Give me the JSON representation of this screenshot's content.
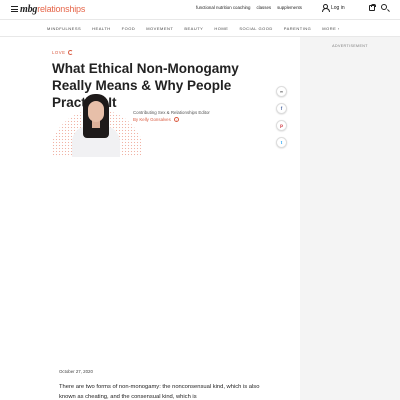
{
  "header": {
    "logo_mbg": "mbg",
    "logo_suffix": "relationships",
    "links": [
      "functional nutrition coaching",
      "classes",
      "supplements"
    ],
    "login_label": "Log in"
  },
  "nav": {
    "items": [
      "MINDFULNESS",
      "HEALTH",
      "FOOD",
      "MOVEMENT",
      "BEAUTY",
      "HOME",
      "SOCIAL GOOD",
      "PARENTING",
      "MORE"
    ]
  },
  "rail": {
    "ad_label": "ADVERTISEMENT"
  },
  "article": {
    "category": "LOVE",
    "title": "What Ethical Non-Monogamy Really Means & Why People Practice It",
    "author_role": "Contributing Sex & Relationships Editor",
    "author_name": "By Kelly Gonsalves",
    "date": "October 27, 2020",
    "body": "There are two forms of non-monogamy: the nonconsensual kind, which is also known as cheating, and the consensual kind, which is"
  },
  "share": {
    "icons": [
      "link-icon",
      "facebook-icon",
      "pinterest-icon",
      "twitter-icon"
    ]
  },
  "colors": {
    "accent": "#d95b41",
    "rail_bg": "#f4f4f4"
  }
}
